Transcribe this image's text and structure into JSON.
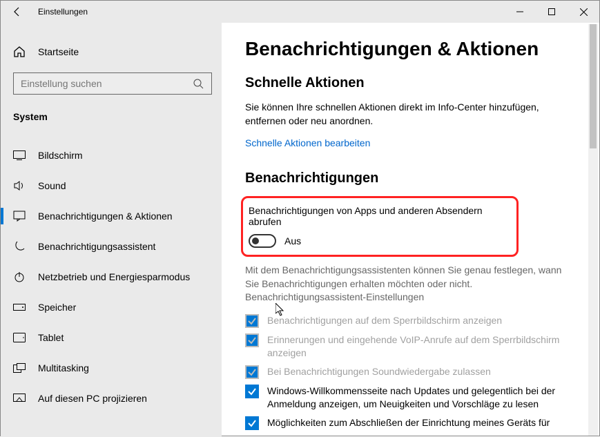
{
  "window": {
    "title": "Einstellungen"
  },
  "sidebar": {
    "home": "Startseite",
    "search_placeholder": "Einstellung suchen",
    "group": "System",
    "items": [
      {
        "label": "Bildschirm"
      },
      {
        "label": "Sound"
      },
      {
        "label": "Benachrichtigungen & Aktionen"
      },
      {
        "label": "Benachrichtigungsassistent"
      },
      {
        "label": "Netzbetrieb und Energiesparmodus"
      },
      {
        "label": "Speicher"
      },
      {
        "label": "Tablet"
      },
      {
        "label": "Multitasking"
      },
      {
        "label": "Auf diesen PC projizieren"
      }
    ]
  },
  "main": {
    "title": "Benachrichtigungen & Aktionen",
    "quick_hdr": "Schnelle Aktionen",
    "quick_desc": "Sie können Ihre schnellen Aktionen direkt im Info-Center hinzufügen, entfernen oder neu anordnen.",
    "quick_link": "Schnelle Aktionen bearbeiten",
    "notif_hdr": "Benachrichtigungen",
    "toggle_label": "Benachrichtigungen von Apps und anderen Absendern abrufen",
    "toggle_state": "Aus",
    "assist_note": "Mit dem Benachrichtigungsassistenten können Sie genau festlegen, wann Sie Benachrichtigungen erhalten möchten oder nicht.",
    "assist_link": "Benachrichtigungsassistent-Einstellungen",
    "cb": [
      "Benachrichtigungen auf dem Sperrbildschirm anzeigen",
      "Erinnerungen und eingehende VoIP-Anrufe auf dem Sperrbildschirm anzeigen",
      "Bei Benachrichtigungen Soundwiedergabe zulassen",
      "Windows-Willkommensseite nach Updates und gelegentlich bei der Anmeldung anzeigen, um Neuigkeiten und Vorschläge zu lesen",
      "Möglichkeiten zum Abschließen der Einrichtung meines Geräts für"
    ]
  }
}
